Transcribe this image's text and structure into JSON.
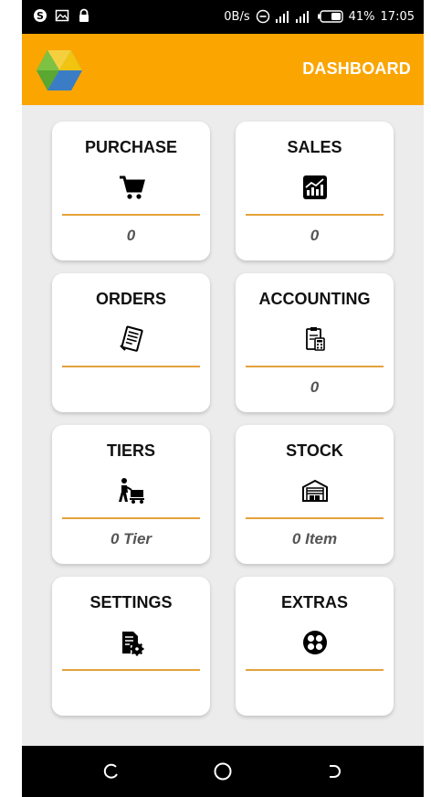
{
  "status_bar": {
    "network_speed": "0B/s",
    "battery_percent": "41%",
    "time": "17:05",
    "icons": [
      "skype-icon",
      "image-icon",
      "lock-icon",
      "dnd-icon",
      "signal-icon",
      "battery-icon"
    ]
  },
  "app_bar": {
    "title": "DASHBOARD",
    "logo": "app-logo"
  },
  "cards": [
    {
      "id": "purchase",
      "label": "PURCHASE",
      "value": "0",
      "icon": "cart-icon"
    },
    {
      "id": "sales",
      "label": "SALES",
      "value": "0",
      "icon": "sales-chart-icon"
    },
    {
      "id": "orders",
      "label": "ORDERS",
      "value": "",
      "icon": "orders-document-icon"
    },
    {
      "id": "accounting",
      "label": "ACCOUNTING",
      "value": "0",
      "icon": "accounting-icon"
    },
    {
      "id": "tiers",
      "label": "TIERS",
      "value": "0 Tier",
      "icon": "tiers-person-cart-icon"
    },
    {
      "id": "stock",
      "label": "STOCK",
      "value": "0 Item",
      "icon": "warehouse-icon"
    },
    {
      "id": "settings",
      "label": "SETTINGS",
      "value": "",
      "icon": "settings-document-gear-icon"
    },
    {
      "id": "extras",
      "label": "EXTRAS",
      "value": "",
      "icon": "extras-grid-icon"
    }
  ],
  "colors": {
    "app_bar": "#fba500",
    "card_rule": "#e4a23a",
    "background": "#ececec",
    "value_text": "#555555"
  },
  "nav_bar": {
    "buttons": [
      "back-icon",
      "home-icon",
      "recents-icon"
    ]
  }
}
